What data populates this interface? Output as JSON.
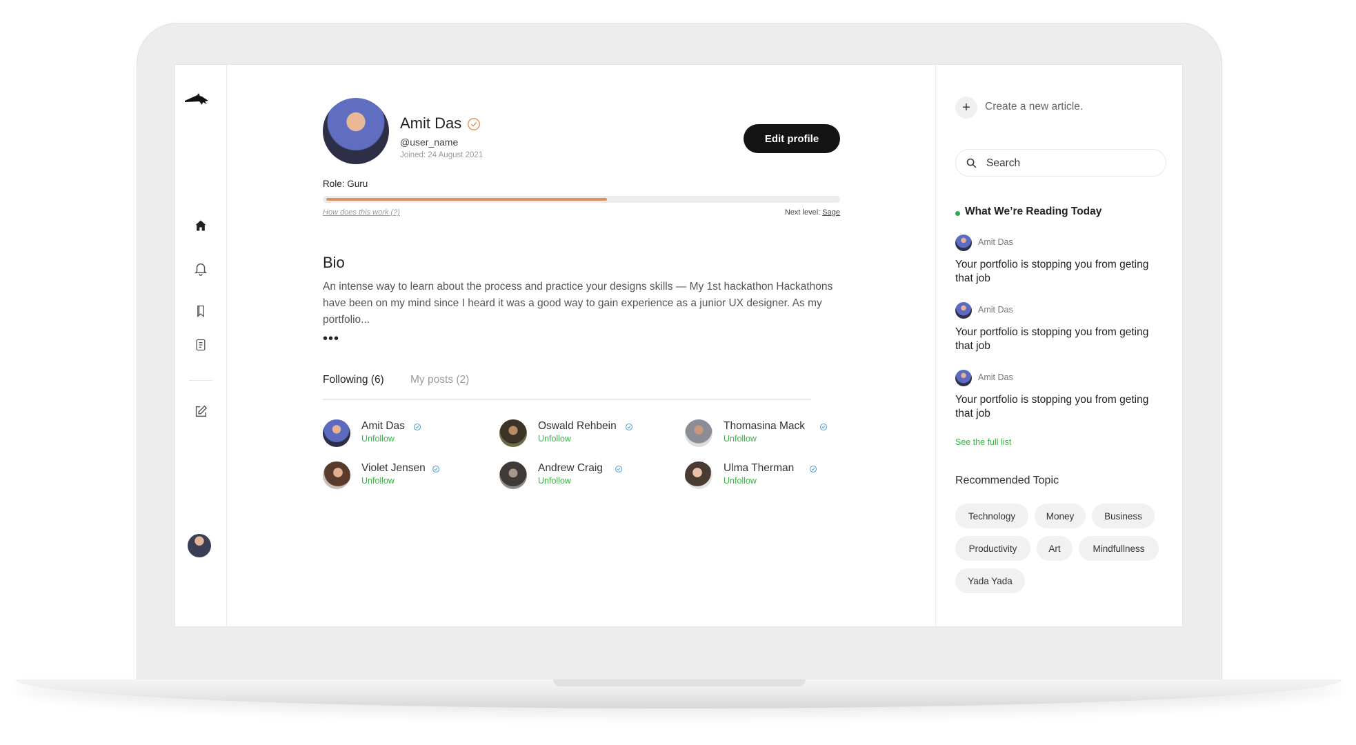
{
  "sidebar": {
    "logo": "logo-icon",
    "nav": [
      "home-icon",
      "bell-icon",
      "bookmark-icon",
      "document-icon",
      "edit-icon"
    ]
  },
  "profile": {
    "name": "Amit Das",
    "username": "@user_name",
    "joined": "Joined: 24 August 2021",
    "edit_label": "Edit profile",
    "role": "Role: Guru",
    "progress": 0.55,
    "how_link": "How does this work (?)",
    "next_level_prefix": "Next level: ",
    "next_level": "Sage"
  },
  "bio": {
    "title": "Bio",
    "text": "An intense way to learn about the process and practice your designs skills — My 1st hackathon Hackathons have been on my mind since I heard it was a good way to gain experience as a junior UX designer. As my portfolio...",
    "more": "•••"
  },
  "tabs": [
    {
      "label": "Following (6)",
      "active": true
    },
    {
      "label": "My posts (2)",
      "active": false
    }
  ],
  "following": [
    {
      "name": "Amit Das",
      "action": "Unfollow"
    },
    {
      "name": "Oswald Rehbein",
      "action": "Unfollow"
    },
    {
      "name": "Thomasina Mack",
      "action": "Unfollow"
    },
    {
      "name": "Violet Jensen",
      "action": "Unfollow"
    },
    {
      "name": "Andrew Craig",
      "action": "Unfollow"
    },
    {
      "name": "Ulma Therman",
      "action": "Unfollow"
    }
  ],
  "right": {
    "create_label": "Create a new article.",
    "search_placeholder": "Search",
    "reading_title": "What We’re Reading Today",
    "articles": [
      {
        "author": "Amit Das",
        "title": "Your portfolio is stopping you from geting that job"
      },
      {
        "author": "Amit Das",
        "title": "Your portfolio is stopping you from geting that job"
      },
      {
        "author": "Amit Das",
        "title": "Your portfolio is stopping you from geting that job"
      }
    ],
    "full_list": "See the full list",
    "rec_title": "Recommended Topic",
    "topics": [
      "Technology",
      "Money",
      "Business",
      "Productivity",
      "Art",
      "Mindfullness",
      "Yada Yada"
    ]
  },
  "colors": {
    "accent_green": "#3bb346",
    "progress_orange": "#dd9266",
    "verified_orange": "#e8935f",
    "verified_blue": "#5aa6d6"
  }
}
